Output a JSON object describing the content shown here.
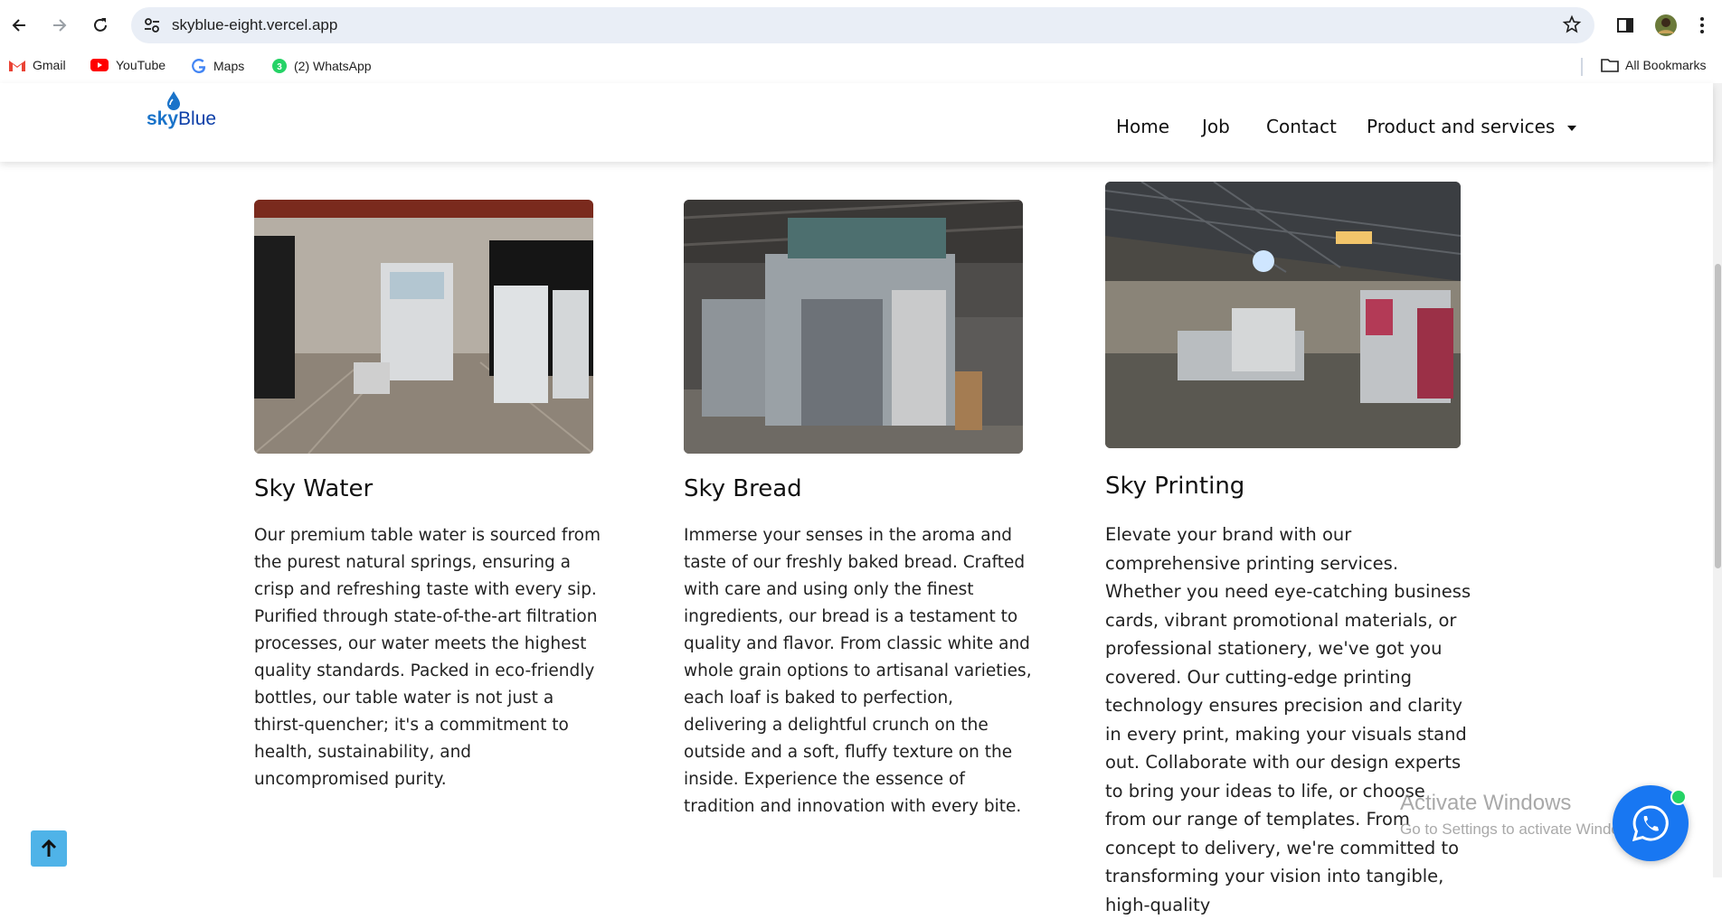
{
  "browser": {
    "url": "skyblue-eight.vercel.app",
    "bookmarks": [
      {
        "label": "Gmail",
        "icon": "gmail-icon"
      },
      {
        "label": "YouTube",
        "icon": "youtube-icon"
      },
      {
        "label": "Maps",
        "icon": "google-icon"
      },
      {
        "label": "(2) WhatsApp",
        "icon": "whatsapp-icon"
      }
    ],
    "all_bookmarks": "All Bookmarks"
  },
  "site": {
    "logo": {
      "sky": "sky",
      "blue": "Blue"
    },
    "nav": {
      "home": "Home",
      "job": "Job",
      "contact": "Contact",
      "products": "Product and services"
    }
  },
  "cards": [
    {
      "title": "Sky Water",
      "text": "Our premium table water is sourced from the purest natural springs, ensuring a crisp and refreshing taste with every sip. Purified through state-of-the-art filtration processes, our water meets the highest quality standards. Packed in eco-friendly bottles, our table water is not just a thirst-quencher; it's a commitment to health, sustainability, and uncompromised purity."
    },
    {
      "title": "Sky Bread",
      "text": "Immerse your senses in the aroma and taste of our freshly baked bread. Crafted with care and using only the finest ingredients, our bread is a testament to quality and flavor. From classic white and whole grain options to artisanal varieties, each loaf is baked to perfection, delivering a delightful crunch on the outside and a soft, fluffy texture on the inside. Experience the essence of tradition and innovation with every bite."
    },
    {
      "title": "Sky Printing",
      "text": "Elevate your brand with our comprehensive printing services. Whether you need eye-catching business cards, vibrant promotional materials, or professional stationery, we've got you covered. Our cutting-edge printing technology ensures precision and clarity in every print, making your visuals stand out. Collaborate with our design experts to bring your ideas to life, or choose from our range of templates. From concept to delivery, we're committed to transforming your vision into tangible, high-quality"
    }
  ],
  "watermark": {
    "line1": "Activate Windows",
    "line2": "Go to Settings to activate Windows."
  },
  "colors": {
    "accent_blue": "#1877f2",
    "back_to_top": "#4fb3e8",
    "whatsapp_green": "#25d366",
    "omnibox": "#e9eef6"
  }
}
